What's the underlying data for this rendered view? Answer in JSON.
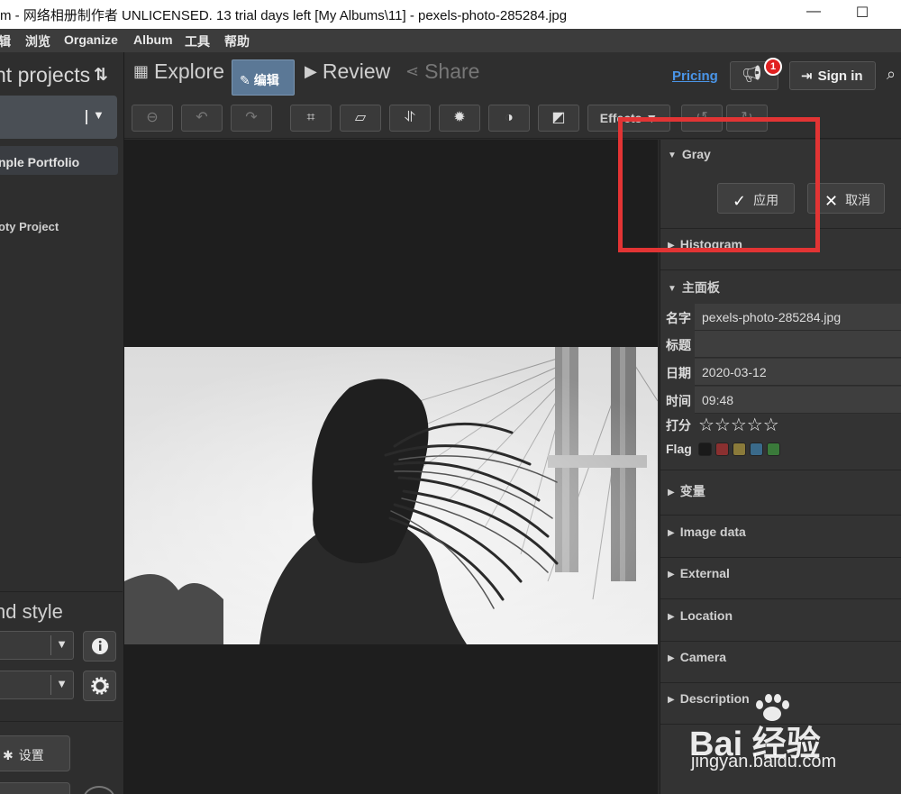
{
  "window": {
    "title": "m - 网络相册制作者 UNLICENSED. 13 trial days left [My Albums\\11] - pexels-photo-285284.jpg",
    "minimize": "—",
    "maximize": "☐"
  },
  "menu": [
    "辑",
    "浏览",
    "Organize",
    "Album",
    "工具",
    "帮助"
  ],
  "left_panel": {
    "title": "nt projects",
    "sort_icon": "sort-icon",
    "items": [
      "nple Portfolio",
      "oty Project"
    ],
    "style_title": "nd style",
    "settings_label": "设置"
  },
  "nav": {
    "explore": "Explore",
    "edit": "编辑",
    "review": "Review",
    "share": "Share",
    "pricing": "Pricing",
    "badge_count": "1",
    "sign_in": "Sign in"
  },
  "toolbar": {
    "effects": "Effects"
  },
  "right_panel": {
    "gray": "Gray",
    "apply": "应用",
    "cancel": "取消",
    "histogram": "Histogram",
    "main_panel": "主面板",
    "fields": {
      "name_label": "名字",
      "name_value": "pexels-photo-285284.jpg",
      "title_label": "标题",
      "title_value": "",
      "date_label": "日期",
      "date_value": "2020-03-12",
      "time_label": "时间",
      "time_value": "09:48",
      "rating_label": "打分",
      "rating_stars": "☆☆☆☆☆",
      "flag_label": "Flag"
    },
    "flag_colors": [
      "#1a1a1a",
      "#8a3030",
      "#8a7a3a",
      "#3a6a8a",
      "#3a7a3a"
    ],
    "sections": [
      "变量",
      "Image data",
      "External",
      "Location",
      "Camera",
      "Description"
    ]
  },
  "watermark": {
    "brand": "Bai 经验",
    "url": "jingyan.baidu.com"
  },
  "colors": {
    "accent": "#5b7896",
    "highlight": "#e23434",
    "link": "#4a95e8"
  }
}
